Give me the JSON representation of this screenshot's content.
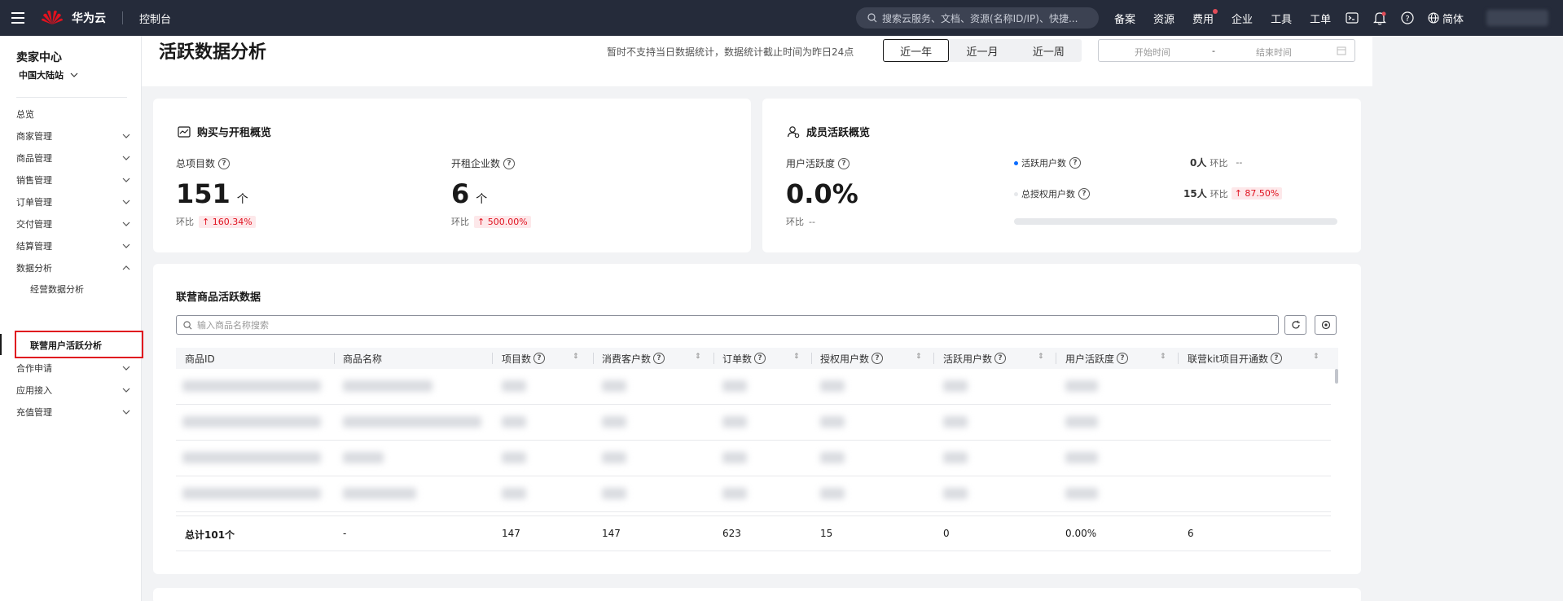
{
  "topbar": {
    "brand": "华为云",
    "logo_text": "HUAWEI",
    "console": "控制台",
    "search_placeholder": "搜索云服务、文档、资源(名称ID/IP)、快捷...",
    "nav": [
      "备案",
      "资源",
      "费用",
      "企业",
      "工具",
      "工单"
    ],
    "language": "简体"
  },
  "sidebar": {
    "title": "卖家中心",
    "region": "中国大陆站",
    "overview": "总览",
    "menu": [
      "商家管理",
      "商品管理",
      "销售管理",
      "订单管理",
      "交付管理",
      "结算管理",
      "数据分析"
    ],
    "sub_items": [
      "经营数据分析",
      "联营用户活跃分析"
    ],
    "menu_after": [
      "合作申请",
      "应用接入",
      "充值管理"
    ]
  },
  "header": {
    "title": "活跃数据分析",
    "notice": "暂时不支持当日数据统计，数据统计截止时间为昨日24点",
    "ranges": [
      "近一年",
      "近一月",
      "近一周"
    ],
    "selected_range": "近一年",
    "start_placeholder": "开始时间",
    "separator": "-",
    "end_placeholder": "结束时间"
  },
  "purchase_card": {
    "title": "购买与开租概览",
    "total_projects_label": "总项目数",
    "total_projects": "151",
    "total_projects_trend": "个",
    "ring_label": "环比",
    "total_projects_change": "↑ 160.34%",
    "companies_label": "开租企业数",
    "companies": "6",
    "companies_trend": "个",
    "companies_change": "↑ 500.00%"
  },
  "member_card": {
    "title": "成员活跃概览",
    "activity_label": "用户活跃度",
    "activity_value": "0.0%",
    "ring_label": "环比",
    "activity_change": "--",
    "active_users_label": "活跃用户数",
    "active_users": "0人",
    "active_users_change": "--",
    "auth_users_label": "总授权用户数",
    "auth_users": "15人",
    "auth_users_change": "↑ 87.50%",
    "progress_fraction": 0.0
  },
  "table_card": {
    "title": "联营商品活跃数据",
    "search_placeholder": "输入商品名称搜索",
    "columns": [
      "商品ID",
      "商品名称",
      "项目数",
      "消费客户数",
      "订单数",
      "授权用户数",
      "活跃用户数",
      "用户活跃度",
      "联营kit项目开通数"
    ],
    "footer": [
      "总计101个",
      "-",
      "147",
      "147",
      "623",
      "15",
      "0",
      "0.00%",
      "6"
    ]
  },
  "colors": {
    "topbar": "#252b3a",
    "accent_red": "#e0121f",
    "accent_blue": "#0a6cff"
  }
}
